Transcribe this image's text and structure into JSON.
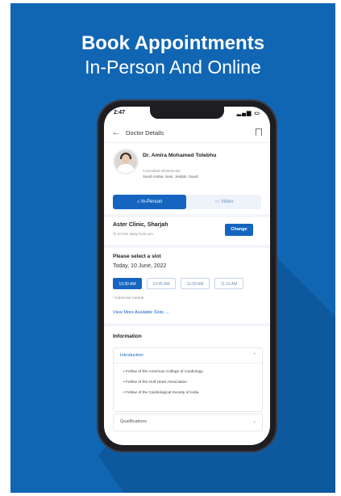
{
  "headline": {
    "line1": "Book Appointments",
    "line2": "In-Person And Online"
  },
  "status_bar": {
    "time": "2:47",
    "icons": "▂▄▆ ▭"
  },
  "appbar": {
    "back_icon": "arrow-left",
    "title": "Doctor Details",
    "bookmark_icon": "bookmark"
  },
  "doctor": {
    "name": "Dr. Amira Mohamed Tolebhu",
    "specialty": "Consultant Obstetrician",
    "location_line": "Saudi Arabia, Nasr, Jeddah, Saudi"
  },
  "mode_tabs": [
    {
      "label": "⌂ In-Person",
      "selected": true
    },
    {
      "label": "▭ Video",
      "selected": false
    }
  ],
  "clinic": {
    "name": "Aster Clinic, Sharjah",
    "sub": "⦿ 3.0 km away from you",
    "change_label": "Change"
  },
  "slots": {
    "label": "Please select a slot",
    "date": "Today, 10 June, 2022",
    "times": [
      "10:30 AM",
      "10:45 AM",
      "11:00 AM",
      "11:15 AM"
    ],
    "selected_index": 0,
    "timezone": "* Indonesia Central",
    "view_more": "View More Available Slots  →"
  },
  "information": {
    "title": "Information",
    "intro_heading": "Introduction",
    "intro_items": [
      "• Fellow of the American College of Cardiology",
      "• Fellow of the Gulf Heart Association",
      "• Fellow of the Cardiological Society of India"
    ],
    "qual_heading": "Qualifications"
  },
  "colors": {
    "background": "#1166b3",
    "accent": "#1565c0"
  }
}
